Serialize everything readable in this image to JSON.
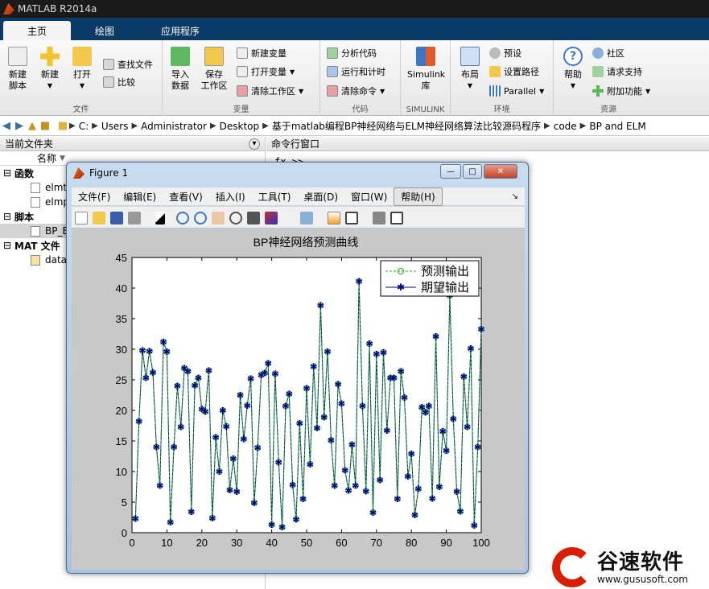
{
  "app": {
    "title": "MATLAB R2014a"
  },
  "tabs": [
    "主页",
    "绘图",
    "应用程序"
  ],
  "ribbon": {
    "file": {
      "label": "文件",
      "new_script": "新建\n脚本",
      "new": "新建",
      "open": "打开",
      "find_files": "查找文件",
      "compare": "比较"
    },
    "variable": {
      "label": "变量",
      "import": "导入\n数据",
      "save_ws": "保存\n工作区",
      "new_var": "新建变量",
      "open_var": "打开变量",
      "clear_ws": "清除工作区"
    },
    "code": {
      "label": "代码",
      "analyze": "分析代码",
      "run_time": "运行和计时",
      "clear_cmd": "清除命令"
    },
    "simulink": {
      "label": "SIMULINK",
      "lib": "Simulink\n库"
    },
    "env": {
      "label": "环境",
      "layout": "布局",
      "prefs": "预设",
      "set_path": "设置路径",
      "parallel": "Parallel"
    },
    "resources": {
      "label": "资源",
      "help": "帮助",
      "community": "社区",
      "support": "请求支持",
      "addons": "附加功能"
    }
  },
  "address": {
    "segments": [
      "C:",
      "Users",
      "Administrator",
      "Desktop",
      "基于matlab编程BP神经网络与ELM神经网络算法比较源码程序",
      "code",
      "BP and ELM"
    ]
  },
  "left_panel": {
    "title": "当前文件夹",
    "col_name": "名称",
    "groups": [
      {
        "label": "函数",
        "items": [
          "elmt",
          "elmp"
        ]
      },
      {
        "label": "脚本",
        "items": [
          "BP_E"
        ]
      },
      {
        "label": "MAT 文件",
        "items": [
          "data"
        ]
      }
    ]
  },
  "cmd_panel": {
    "title": "命令行窗口",
    "prompt": "fx >>"
  },
  "figure": {
    "title": "Figure 1",
    "menu": [
      "文件(F)",
      "编辑(E)",
      "查看(V)",
      "插入(I)",
      "工具(T)",
      "桌面(D)",
      "窗口(W)",
      "帮助(H)"
    ],
    "win_min": "—",
    "win_max": "□",
    "win_close": "✕"
  },
  "chart_data": {
    "type": "line",
    "title": "BP神经网络预测曲线",
    "xlabel": "",
    "ylabel": "",
    "xlim": [
      0,
      100
    ],
    "ylim": [
      0,
      45
    ],
    "xticks": [
      0,
      10,
      20,
      30,
      40,
      50,
      60,
      70,
      80,
      90,
      100
    ],
    "yticks": [
      0,
      5,
      10,
      15,
      20,
      25,
      30,
      35,
      40,
      45
    ],
    "grid": false,
    "legend_position": "top-right",
    "series": [
      {
        "name": "预测输出",
        "color": "#1ab31a",
        "style": "dashed",
        "marker": "circle"
      },
      {
        "name": "期望输出",
        "color": "#00008b",
        "style": "solid",
        "marker": "star"
      }
    ],
    "x": [
      1,
      2,
      3,
      4,
      5,
      6,
      7,
      8,
      9,
      10,
      11,
      12,
      13,
      14,
      15,
      16,
      17,
      18,
      19,
      20,
      21,
      22,
      23,
      24,
      25,
      26,
      27,
      28,
      29,
      30,
      31,
      32,
      33,
      34,
      35,
      36,
      37,
      38,
      39,
      40,
      41,
      42,
      43,
      44,
      45,
      46,
      47,
      48,
      49,
      50,
      51,
      52,
      53,
      54,
      55,
      56,
      57,
      58,
      59,
      60,
      61,
      62,
      63,
      64,
      65,
      66,
      67,
      68,
      69,
      70,
      71,
      72,
      73,
      74,
      75,
      76,
      77,
      78,
      79,
      80,
      81,
      82,
      83,
      84,
      85,
      86,
      87,
      88,
      89,
      90,
      91,
      92,
      93,
      94,
      95,
      96,
      97,
      98,
      99,
      100
    ],
    "values": [
      2.3,
      18.2,
      29.8,
      25.3,
      29.7,
      26.2,
      14,
      7.7,
      31.2,
      29.6,
      1.7,
      14,
      24,
      17.3,
      26.9,
      26.4,
      3.4,
      24.1,
      25.3,
      20.2,
      19.8,
      26.5,
      2.4,
      15.6,
      10,
      20,
      17.4,
      7,
      12.1,
      6.7,
      22.5,
      15.3,
      20.8,
      25.2,
      4.9,
      13.9,
      25.8,
      26.1,
      27.7,
      1.3,
      26,
      11.5,
      0.9,
      20.7,
      22.7,
      7.8,
      2.2,
      17.9,
      5.5,
      23.6,
      11.2,
      27.2,
      17.1,
      37.2,
      18.9,
      29.6,
      15.1,
      7.7,
      24.3,
      21.1,
      10.2,
      6.9,
      14.4,
      7.7,
      41.1,
      20.7,
      6.8,
      30.9,
      3.3,
      29.2,
      8.6,
      29.5,
      16.7,
      25.3,
      25.3,
      5.5,
      26.4,
      22.1,
      9.2,
      12.9,
      2.9,
      7.2,
      20.5,
      19.7,
      20.7,
      5.6,
      32.1,
      7.5,
      16.6,
      13.4,
      38.8,
      18.6,
      6.7,
      3.5,
      25.5,
      17.3,
      30.1,
      1.2,
      14,
      33.3
    ]
  },
  "watermark": {
    "brand": "谷速软件",
    "url": "www.gususoft.com"
  }
}
